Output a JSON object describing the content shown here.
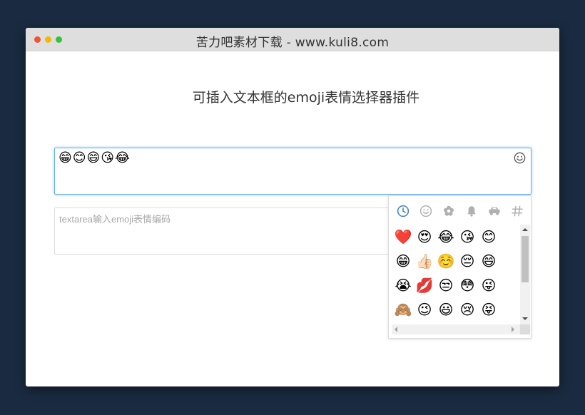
{
  "window": {
    "title": "苦力吧素材下载 - www.kuli8.com",
    "traffic_lights": [
      "#f2542d",
      "#f5b800",
      "#3ac13a"
    ]
  },
  "page": {
    "heading": "可插入文本框的emoji表情选择器插件"
  },
  "editor": {
    "content": "😁😊😄😘😂",
    "toggle_icon": "smiley-face-icon"
  },
  "textarea": {
    "value": "",
    "placeholder": "textarea输入emoji表情编码"
  },
  "picker": {
    "accent_color": "#3b82c4",
    "inactive_color": "#b0b0b0",
    "categories": [
      {
        "name": "recent",
        "icon": "clock-icon",
        "active": true
      },
      {
        "name": "people",
        "icon": "smiley-icon",
        "active": false
      },
      {
        "name": "nature",
        "icon": "flower-icon",
        "active": false
      },
      {
        "name": "objects",
        "icon": "bell-icon",
        "active": false
      },
      {
        "name": "places",
        "icon": "car-icon",
        "active": false
      },
      {
        "name": "symbols",
        "icon": "hash-icon",
        "active": false
      }
    ],
    "rows": [
      [
        "❤️",
        "😍",
        "😂",
        "😘",
        "😊"
      ],
      [
        "😁",
        "👍🏻",
        "☺️",
        "😔",
        "😄"
      ],
      [
        "😭",
        "💋",
        "😒",
        "😳",
        "😜"
      ],
      [
        "🙈",
        "😉",
        "😃",
        "😢",
        "😝"
      ]
    ]
  }
}
